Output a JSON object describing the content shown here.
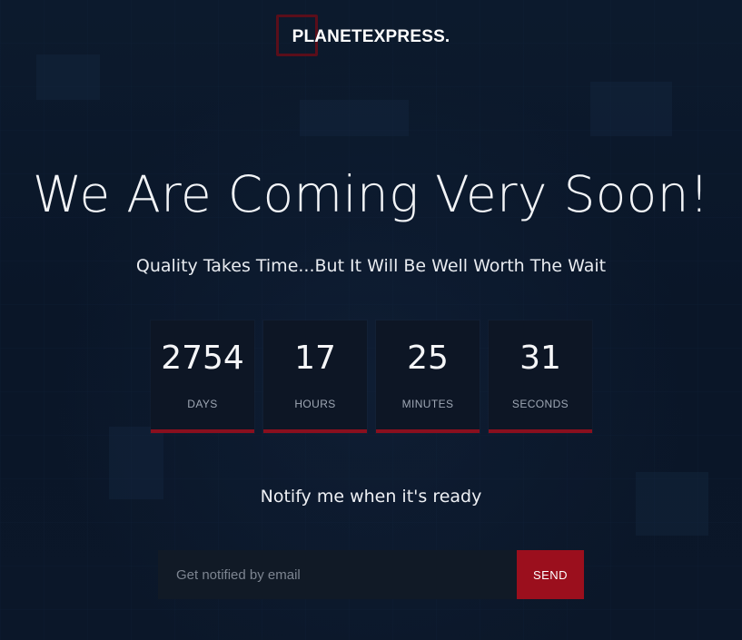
{
  "brand": {
    "logo_text": "PLANETEXPRESS."
  },
  "hero": {
    "headline": "We Are Coming Very Soon!",
    "subline": "Quality Takes Time...But It Will Be Well Worth The Wait"
  },
  "countdown": [
    {
      "value": "2754",
      "label": "DAYS"
    },
    {
      "value": "17",
      "label": "HOURS"
    },
    {
      "value": "25",
      "label": "MINUTES"
    },
    {
      "value": "31",
      "label": "SECONDS"
    }
  ],
  "notify": {
    "heading": "Notify me when it's ready",
    "email_placeholder": "Get notified by email",
    "email_value": "",
    "send_label": "SEND"
  },
  "colors": {
    "background": "#0b1729",
    "accent": "#9b0f1d",
    "box_background": "#0d1625"
  }
}
